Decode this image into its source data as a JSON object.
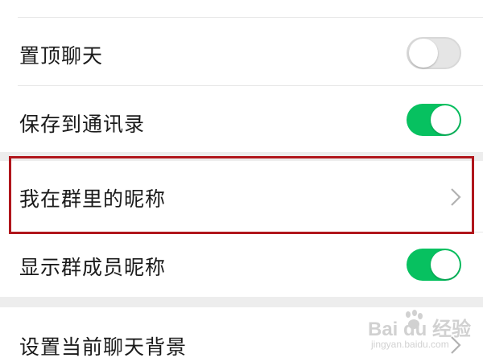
{
  "settings": {
    "items": [
      {
        "label": "置顶聊天",
        "control": "toggle",
        "state": "off"
      },
      {
        "label": "保存到通讯录",
        "control": "toggle",
        "state": "on"
      },
      {
        "label": "我在群里的昵称",
        "control": "chevron",
        "highlighted": true
      },
      {
        "label": "显示群成员昵称",
        "control": "toggle",
        "state": "on"
      },
      {
        "label": "设置当前聊天背景",
        "control": "chevron"
      }
    ]
  },
  "colors": {
    "toggle_on": "#07c160",
    "toggle_off": "#e5e5e5",
    "highlight_border": "#b0161c",
    "section_gap": "#ededed"
  },
  "watermark": {
    "brand": "Bai du 经验",
    "sub": "jingyan.baidu.com"
  }
}
